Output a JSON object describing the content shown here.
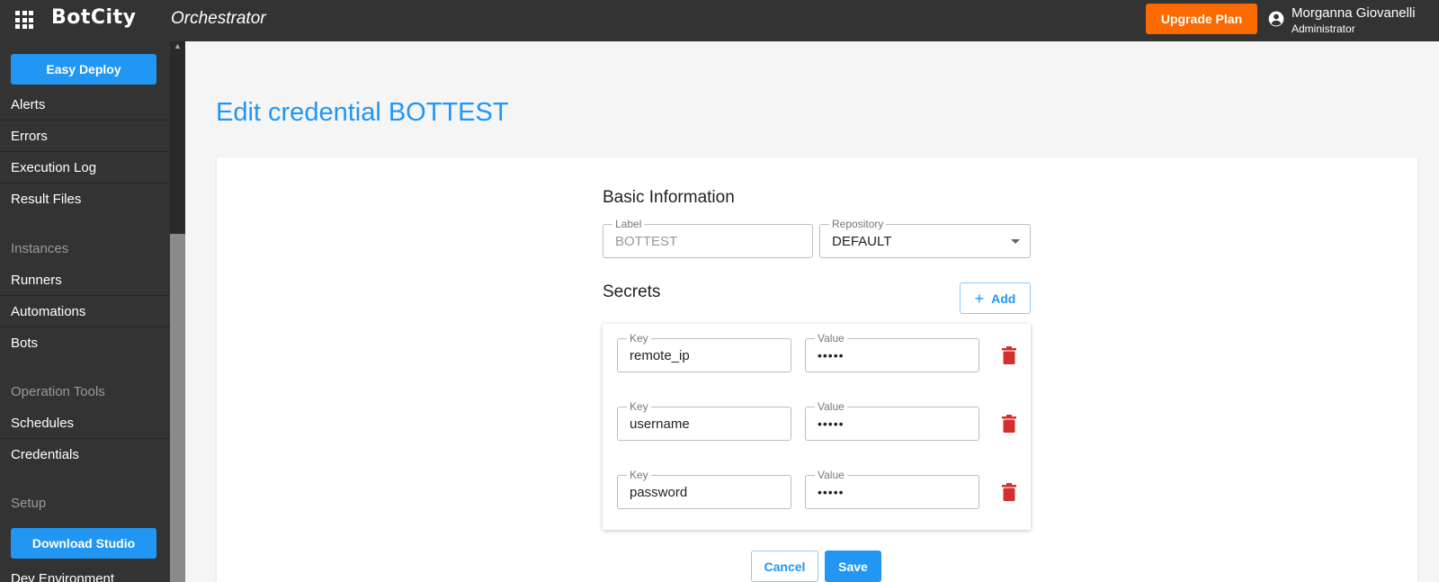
{
  "header": {
    "brand": "BotCity",
    "app_name": "Orchestrator",
    "upgrade_label": "Upgrade Plan",
    "user_name": "Morganna Giovanelli",
    "user_role": "Administrator"
  },
  "sidebar": {
    "easy_deploy_label": "Easy Deploy",
    "items_group1": [
      "Alerts",
      "Errors",
      "Execution Log",
      "Result Files"
    ],
    "section_instances": "Instances",
    "items_group2": [
      "Runners",
      "Automations",
      "Bots"
    ],
    "section_operation_tools": "Operation Tools",
    "items_group3": [
      "Schedules",
      "Credentials"
    ],
    "section_setup": "Setup",
    "download_studio_label": "Download Studio",
    "dev_environment_label": "Dev Environment"
  },
  "page": {
    "title": "Edit credential BOTTEST"
  },
  "basic_info": {
    "title": "Basic Information",
    "label_field": {
      "label": "Label",
      "value": "BOTTEST"
    },
    "repository_field": {
      "label": "Repository",
      "value": "DEFAULT"
    }
  },
  "secrets": {
    "title": "Secrets",
    "add_label": "Add",
    "key_label": "Key",
    "value_label": "Value",
    "rows": [
      {
        "key": "remote_ip",
        "value": "•••••"
      },
      {
        "key": "username",
        "value": "•••••"
      },
      {
        "key": "password",
        "value": "•••••"
      }
    ]
  },
  "actions": {
    "cancel_label": "Cancel",
    "save_label": "Save"
  },
  "colors": {
    "accent": "#2196f3",
    "upgrade": "#fb6a00",
    "topbar": "#333333",
    "danger": "#d32f2f"
  }
}
